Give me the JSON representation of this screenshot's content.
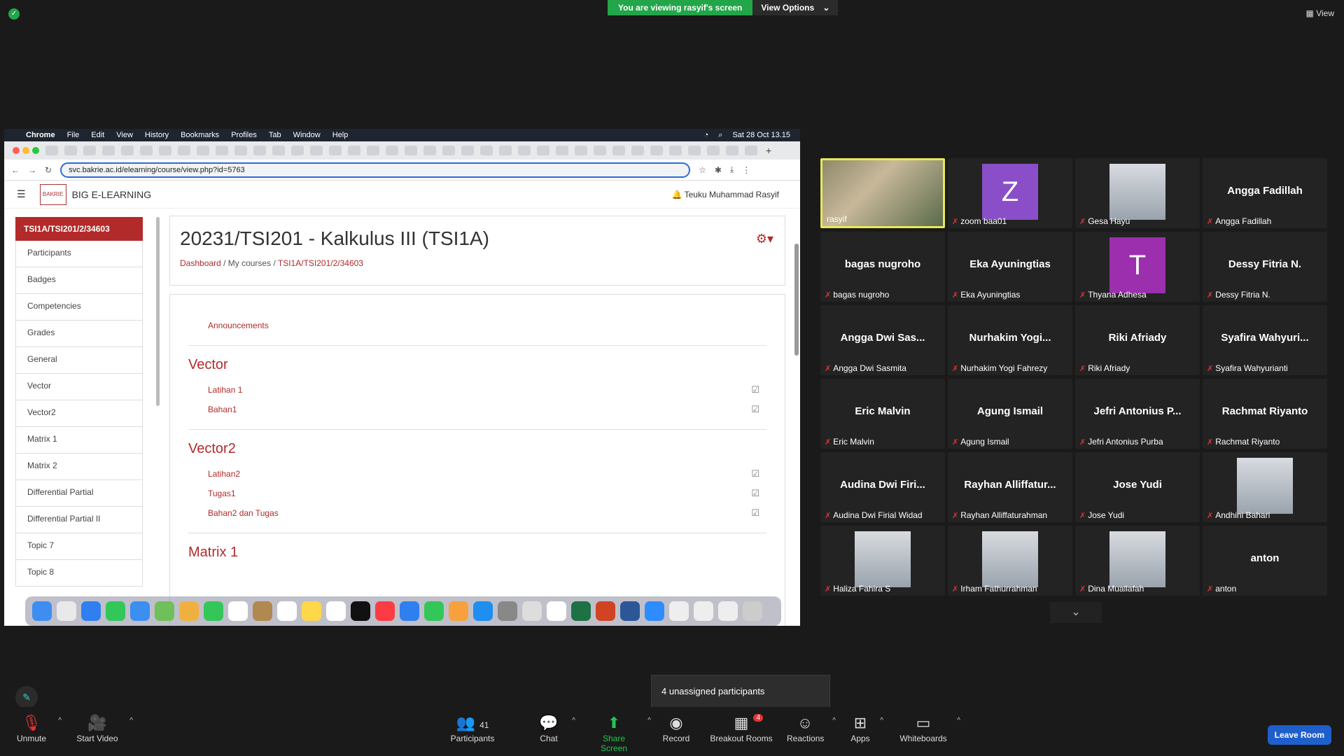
{
  "zoom": {
    "banner_text": "You are viewing rasyif's screen",
    "view_options": "View Options",
    "view_button": "View",
    "toast": "4 unassigned participants",
    "toolbar": {
      "unmute": "Unmute",
      "start_video": "Start Video",
      "participants": "Participants",
      "participants_count": "41",
      "chat": "Chat",
      "share_screen": "Share Screen",
      "record": "Record",
      "breakout_rooms": "Breakout Rooms",
      "breakout_badge": "4",
      "reactions": "Reactions",
      "apps": "Apps",
      "whiteboards": "Whiteboards",
      "leave": "Leave Room"
    },
    "participants": [
      {
        "label": "rasyif",
        "display": "",
        "type": "video"
      },
      {
        "label": "zoom baa01",
        "display": "Z",
        "type": "letter",
        "color": "#8a4fc8"
      },
      {
        "label": "Gesa Hayu",
        "display": "",
        "type": "photo"
      },
      {
        "label": "Angga Fadillah",
        "display": "Angga Fadillah",
        "type": "name"
      },
      {
        "label": "bagas nugroho",
        "display": "bagas nugroho",
        "type": "name"
      },
      {
        "label": "Eka Ayuningtias",
        "display": "Eka Ayuningtias",
        "type": "name"
      },
      {
        "label": "Thyana Adhesa",
        "display": "T",
        "type": "letter",
        "color": "#9b2fae"
      },
      {
        "label": "Dessy Fitria N.",
        "display": "Dessy Fitria N.",
        "type": "name"
      },
      {
        "label": "Angga Dwi Sasmita",
        "display": "Angga Dwi Sas...",
        "type": "name"
      },
      {
        "label": "Nurhakim Yogi Fahrezy",
        "display": "Nurhakim Yogi...",
        "type": "name"
      },
      {
        "label": "Riki Afriady",
        "display": "Riki Afriady",
        "type": "name"
      },
      {
        "label": "Syafira Wahyurianti",
        "display": "Syafira Wahyuri...",
        "type": "name"
      },
      {
        "label": "Eric Malvin",
        "display": "Eric Malvin",
        "type": "name"
      },
      {
        "label": "Agung Ismail",
        "display": "Agung Ismail",
        "type": "name"
      },
      {
        "label": "Jefri Antonius Purba",
        "display": "Jefri Antonius P...",
        "type": "name"
      },
      {
        "label": "Rachmat Riyanto",
        "display": "Rachmat Riyanto",
        "type": "name"
      },
      {
        "label": "Audina Dwi Firial Widad",
        "display": "Audina Dwi Firi...",
        "type": "name"
      },
      {
        "label": "Rayhan Alliffaturahman",
        "display": "Rayhan Alliffatur...",
        "type": "name"
      },
      {
        "label": "Jose Yudi",
        "display": "Jose Yudi",
        "type": "name"
      },
      {
        "label": "Andhini Bahari",
        "display": "",
        "type": "photo"
      },
      {
        "label": "Haliza Fahira S",
        "display": "",
        "type": "photo"
      },
      {
        "label": "Irham Fathurrahman",
        "display": "",
        "type": "photo"
      },
      {
        "label": "Dina Muallafah",
        "display": "",
        "type": "photo"
      },
      {
        "label": "anton",
        "display": "anton",
        "type": "name"
      }
    ]
  },
  "shared": {
    "menubar": [
      "Chrome",
      "File",
      "Edit",
      "View",
      "History",
      "Bookmarks",
      "Profiles",
      "Tab",
      "Window",
      "Help"
    ],
    "clock": "Sat 28 Oct  13.15",
    "url": "svc.bakrie.ac.id/elearning/course/view.php?id=5763",
    "site_name": "BIG E-LEARNING",
    "logo_text": "BAKRIE",
    "user_name": "Teuku Muhammad Rasyif",
    "sidebar_active": "TSI1A/TSI201/2/34603",
    "sidebar_items": [
      "Participants",
      "Badges",
      "Competencies",
      "Grades",
      "General",
      "Vector",
      "Vector2",
      "Matrix 1",
      "Matrix 2",
      "Differential Partial",
      "Differential Partial II",
      "Topic 7",
      "Topic 8"
    ],
    "course_title": "20231/TSI201 - Kalkulus III (TSI1A)",
    "crumb_dashboard": "Dashboard",
    "crumb_courses": "My courses",
    "crumb_course": "TSI1A/TSI201/2/34603",
    "announcements": "Announcements",
    "section1_title": "Vector",
    "section1_items": [
      "Latihan 1",
      "Bahan1"
    ],
    "section2_title": "Vector2",
    "section2_items": [
      "Latihan2",
      "Tugas1",
      "Bahan2 dan Tugas"
    ],
    "section3_title": "Matrix 1"
  }
}
